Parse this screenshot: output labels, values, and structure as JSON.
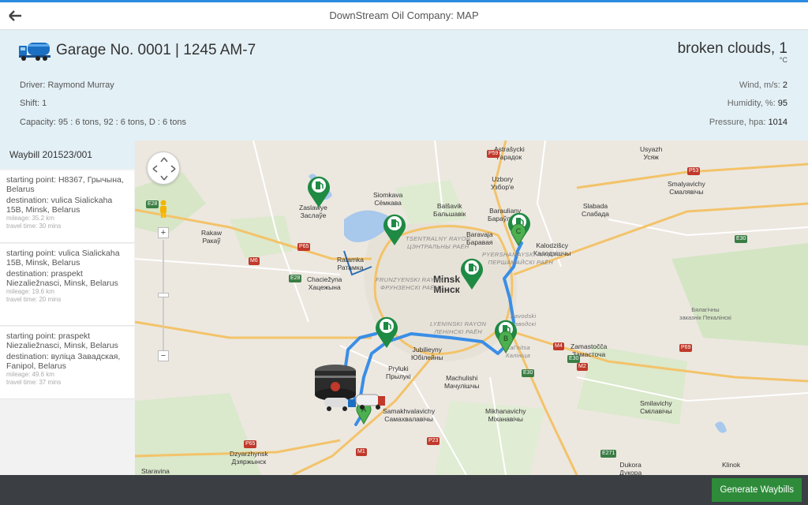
{
  "app": {
    "title": "DownStream Oil Company: MAP"
  },
  "vehicle": {
    "title": "Garage No. 0001 | 1245 AM-7",
    "driver": "Driver: Raymond Murray",
    "shift": "Shift: 1",
    "capacity": "Capacity: 95 : 6 tons, 92 : 6 tons, D : 6 tons"
  },
  "weather": {
    "summary": "broken clouds, 1",
    "unit": "°C",
    "wind_label": "Wind, m/s:",
    "wind_value": "2",
    "humidity_label": "Humidity, %:",
    "humidity_value": "95",
    "pressure_label": "Pressure, hpa:",
    "pressure_value": "1014"
  },
  "waybill": {
    "title": "Waybill 201523/001",
    "routes": [
      {
        "start": "starting point: H8367, Грычына, Belarus",
        "destination": "destination: vulica Sialickaha 15B, Minsk, Belarus",
        "mileage": "mileage: 35.2 km",
        "travel_time": "travel time: 30 mins"
      },
      {
        "start": "starting point: vulica Sialickaha 15B, Minsk, Belarus",
        "destination": "destination: praspekt Niezaliežnasci, Minsk, Belarus",
        "mileage": "mileage: 19.6 km",
        "travel_time": "travel time: 20 mins"
      },
      {
        "start": "starting point: praspekt Niezaliežnasci, Minsk, Belarus",
        "destination": "destination: вуліца Завадская, Fanipol, Belarus",
        "mileage": "mileage: 49.6 km",
        "travel_time": "travel time: 37 mins"
      }
    ]
  },
  "map": {
    "zoom_in": "+",
    "zoom_out": "−",
    "markers": [
      "A",
      "B",
      "C"
    ],
    "colors": {
      "route": "#3a8ee6",
      "pin": "#1e8a44",
      "marker": "#4caf50",
      "water": "#a8c8ec",
      "park": "#c8dfb0"
    },
    "places": [
      {
        "name": "Astrašycki\nГарадок",
        "kind": "town"
      },
      {
        "name": "Uzbory\nУзбор'е",
        "kind": "town"
      },
      {
        "name": "Usyazh\nУсяж",
        "kind": "town"
      },
      {
        "name": "Smalyavichy\nСмалявічы",
        "kind": "town"
      },
      {
        "name": "Siomkava\nСёмкава",
        "kind": "town"
      },
      {
        "name": "Balšavik\nБальшавік",
        "kind": "town"
      },
      {
        "name": "Zaslawye\nЗаслаўе",
        "kind": "town"
      },
      {
        "name": "Baraulianу\nБараўляны",
        "kind": "town"
      },
      {
        "name": "Slabada\nСлабада",
        "kind": "town"
      },
      {
        "name": "Rakaw\nРакаў",
        "kind": "town"
      },
      {
        "name": "Ratamka\nРатамка",
        "kind": "town"
      },
      {
        "name": "Baravaja\nБаравая",
        "kind": "town"
      },
      {
        "name": "Kalodzišcy\nКалодзішчы",
        "kind": "town"
      },
      {
        "name": "Chaciežyna\nХацежына",
        "kind": "town"
      },
      {
        "name": "Minsk\nМінск",
        "kind": "city"
      },
      {
        "name": "Jubilieyny\nЮбілейны",
        "kind": "town"
      },
      {
        "name": "Pryluki\nПрылукі",
        "kind": "town"
      },
      {
        "name": "Machulishi\nМачулішчы",
        "kind": "town"
      },
      {
        "name": "Zamastočča\nЗамасточа",
        "kind": "town"
      },
      {
        "name": "Samakhvalavichy\nСамахвалавічы",
        "kind": "town"
      },
      {
        "name": "Mikhanavichy\nМіханавічы",
        "kind": "town"
      },
      {
        "name": "Smilavichy\nСмілавічы",
        "kind": "town"
      },
      {
        "name": "Dzyarzhynsk\nДзяржынск",
        "kind": "town"
      },
      {
        "name": "Dukora\nДукора",
        "kind": "town"
      },
      {
        "name": "Klinok",
        "kind": "town"
      },
      {
        "name": "Astrašycki",
        "kind": "town"
      },
      {
        "name": "Бялагічны\nзаказнік Пекалінскі",
        "kind": "reserve"
      },
      {
        "name": "Staravina",
        "kind": "town"
      }
    ],
    "districts": [
      "TSENTRALNY RAYON\nЦЭНТРАЛЬНЫ РАЁН",
      "PYERSHAMAYSKI RAYON\nПЕРШАМАЙСКІ РАЁН",
      "FRUNZYENSKI RAYON\nФРУНЗЕНСКІ РАЁН",
      "LYENINSKI RAYON\nЛЕНІНСКІ РАЁН",
      "Zavodski\nЗаводскі",
      "Kal'nitsa\nКалініца"
    ],
    "roads": [
      "P59",
      "P53",
      "E28",
      "M6",
      "P65",
      "E28",
      "R28",
      "M2",
      "E30",
      "M4",
      "E30",
      "P69",
      "P65",
      "M1",
      "E30",
      "P23",
      "E271",
      "M1",
      "P23"
    ]
  },
  "actions": {
    "generate": "Generate Waybills"
  }
}
